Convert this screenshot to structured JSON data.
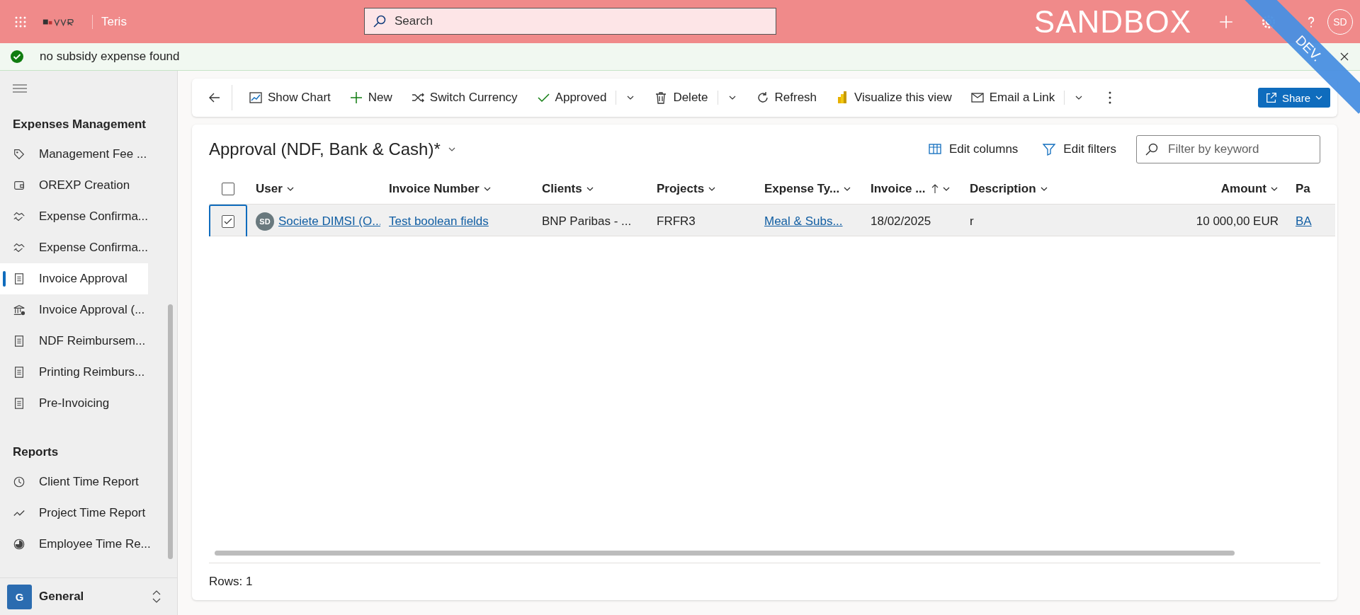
{
  "top_bar": {
    "brand": "Teris",
    "search": {
      "placeholder": "Search"
    },
    "environment": "SANDBOX",
    "avatar": "SD",
    "ribbon": "DEV."
  },
  "notification": {
    "kind": "success",
    "text": "no subsidy expense found"
  },
  "sidebar": {
    "groups": [
      {
        "title": "Expenses Management",
        "items": [
          {
            "label": "Management Fee ...",
            "kind": "tag",
            "selected": false
          },
          {
            "label": "OREXP Creation",
            "kind": "wallet",
            "selected": false
          },
          {
            "label": "Expense Confirma...",
            "kind": "handshake",
            "selected": false
          },
          {
            "label": "Expense Confirma...",
            "kind": "handshake",
            "selected": false
          },
          {
            "label": "Invoice Approval",
            "kind": "document",
            "selected": true
          },
          {
            "label": "Invoice Approval (...",
            "kind": "bank",
            "selected": false
          },
          {
            "label": "NDF Reimbursem...",
            "kind": "document",
            "selected": false
          },
          {
            "label": "Printing Reimburs...",
            "kind": "document",
            "selected": false
          },
          {
            "label": "Pre-Invoicing",
            "kind": "document",
            "selected": false
          }
        ]
      },
      {
        "title": "Reports",
        "items": [
          {
            "label": "Client Time Report",
            "kind": "clock",
            "selected": false
          },
          {
            "label": "Project Time Report",
            "kind": "trend",
            "selected": false
          },
          {
            "label": "Employee Time Re...",
            "kind": "pie",
            "selected": false
          }
        ]
      }
    ],
    "area": {
      "initial": "G",
      "label": "General"
    }
  },
  "toolbar": [
    {
      "kind": "back"
    },
    {
      "kind": "chart",
      "label": "Show Chart"
    },
    {
      "kind": "plus",
      "label": "New"
    },
    {
      "kind": "shuffle",
      "label": "Switch Currency"
    },
    {
      "kind": "check",
      "label": "Approved"
    },
    {
      "kind": "caret"
    },
    {
      "kind": "trash",
      "label": "Delete"
    },
    {
      "kind": "caret"
    },
    {
      "kind": "refresh",
      "label": "Refresh"
    },
    {
      "kind": "powerbi",
      "label": "Visualize this view"
    },
    {
      "kind": "mail",
      "label": "Email a Link"
    },
    {
      "kind": "caret"
    },
    {
      "kind": "more"
    }
  ],
  "share": {
    "label": "Share"
  },
  "view": {
    "title": "Approval (NDF, Bank & Cash)*",
    "actions": [
      {
        "kind": "columns",
        "label": "Edit columns"
      },
      {
        "kind": "filter",
        "label": "Edit filters"
      }
    ],
    "filter": {
      "placeholder": "Filter by keyword"
    }
  },
  "table": {
    "select_all": {
      "checked": false
    },
    "columns": [
      {
        "label": "User",
        "sorted": false
      },
      {
        "label": "Invoice Number",
        "sorted": false
      },
      {
        "label": "Clients",
        "sorted": false
      },
      {
        "label": "Projects",
        "sorted": false
      },
      {
        "label": "Expense Ty...",
        "sorted": false
      },
      {
        "label": "Invoice ...",
        "sorted": true
      },
      {
        "label": "Description",
        "sorted": false
      },
      {
        "label": "Amount",
        "sorted": false
      },
      {
        "label": "Pa"
      }
    ],
    "rows": [
      {
        "selected": true,
        "avatar": "SD",
        "cells": [
          {
            "kind": "link",
            "text": "Societe DIMSI (O..."
          },
          {
            "kind": "link",
            "text": "Test boolean fields"
          },
          {
            "kind": "text",
            "text": "BNP Paribas - ..."
          },
          {
            "kind": "text",
            "text": "FRFR3"
          },
          {
            "kind": "link",
            "text": "Meal & Subs..."
          },
          {
            "kind": "text",
            "text": "18/02/2025"
          },
          {
            "kind": "text",
            "text": "r"
          },
          {
            "kind": "text",
            "text": "10 000,00 EUR"
          },
          {
            "kind": "link",
            "text": "BA"
          }
        ]
      }
    ]
  },
  "footer": {
    "text": "Rows: 1"
  }
}
